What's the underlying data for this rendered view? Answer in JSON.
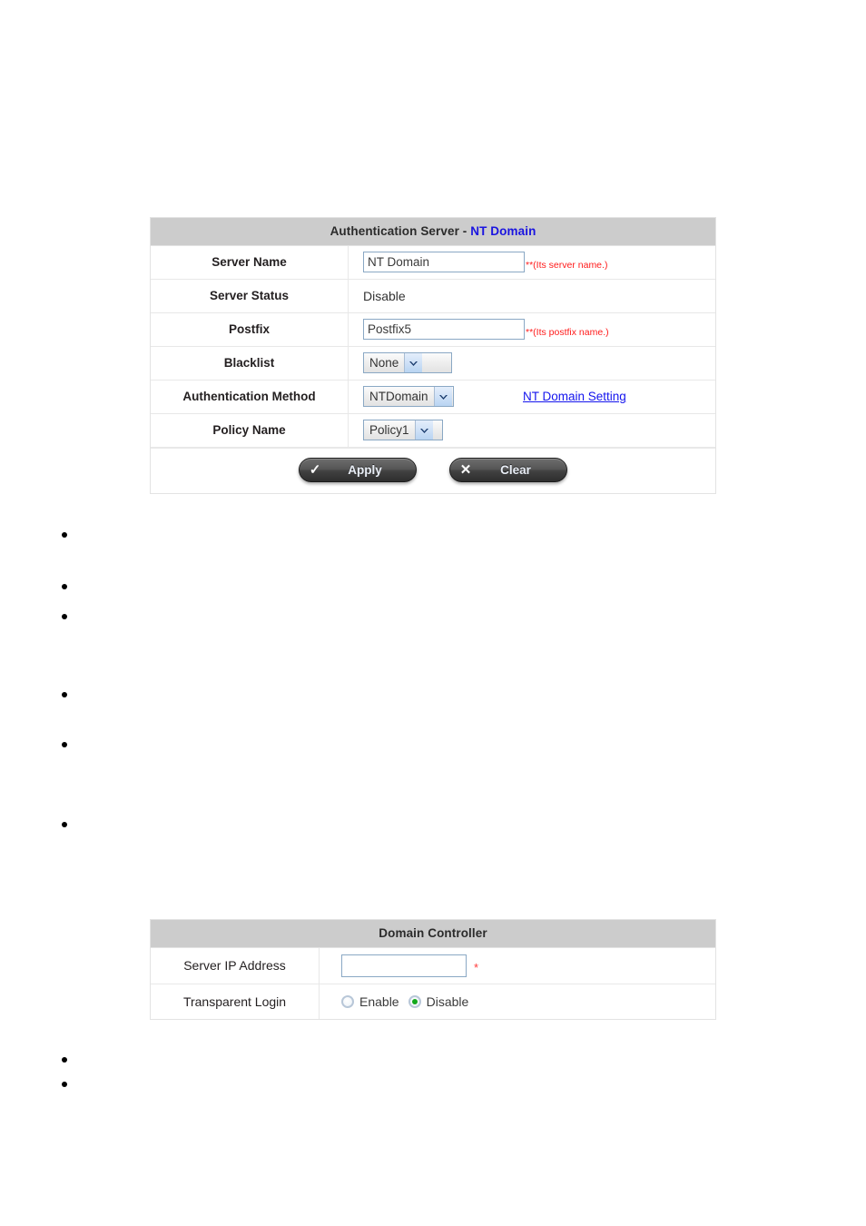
{
  "auth_panel": {
    "title_prefix": "Authentication Server - ",
    "title_accent": "NT Domain",
    "rows": {
      "server_name": {
        "label": "Server Name",
        "value": "NT Domain",
        "hint": "**(Its server name.)"
      },
      "server_status": {
        "label": "Server Status",
        "value": "Disable"
      },
      "postfix": {
        "label": "Postfix",
        "value": "Postfix5",
        "hint": "**(Its postfix name.)"
      },
      "blacklist": {
        "label": "Blacklist",
        "selected": "None",
        "icon": "chevron-down-icon"
      },
      "auth_method": {
        "label": "Authentication Method",
        "selected": "NTDomain",
        "icon": "chevron-down-icon",
        "link_label": "NT Domain Setting"
      },
      "policy_name": {
        "label": "Policy Name",
        "selected": "Policy1",
        "icon": "chevron-down-icon"
      }
    },
    "buttons": {
      "apply": {
        "label": "Apply",
        "icon": "check-icon",
        "glyph": "✓"
      },
      "clear": {
        "label": "Clear",
        "icon": "cross-icon",
        "glyph": "✕"
      }
    }
  },
  "domain_panel": {
    "title": "Domain Controller",
    "rows": {
      "server_ip": {
        "label": "Server IP Address",
        "value": "",
        "required_mark": "*"
      },
      "transparent_login": {
        "label": "Transparent Login",
        "options": [
          {
            "label": "Enable",
            "selected": false
          },
          {
            "label": "Disable",
            "selected": true
          }
        ]
      }
    }
  },
  "bullets": {
    "group_a": [
      "",
      "",
      ""
    ],
    "group_b": [
      "",
      "",
      ""
    ],
    "group_c": [
      "",
      ""
    ]
  },
  "colors": {
    "header_bg": "#cccccc",
    "accent_blue": "#1a14e0",
    "hint_red": "#ff1a1a",
    "radio_green": "#13a81c",
    "link_blue": "#1414ee"
  }
}
